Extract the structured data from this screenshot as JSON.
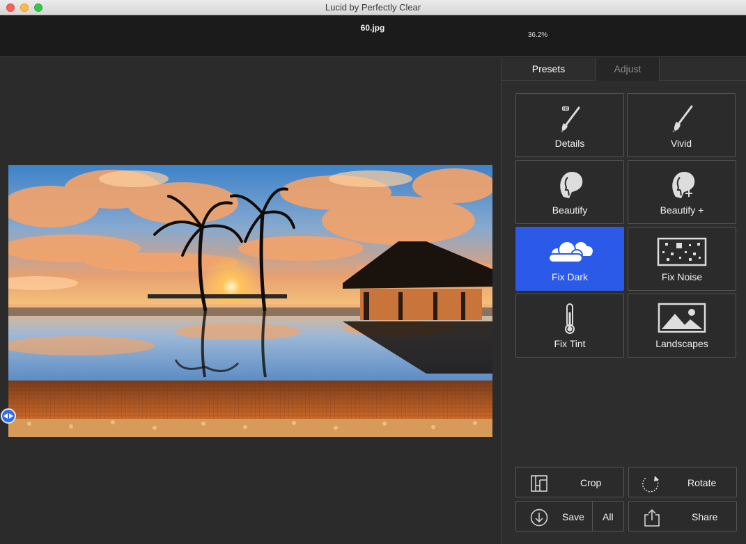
{
  "window": {
    "title": "Lucid by Perfectly Clear"
  },
  "infobar": {
    "filename": "60.jpg",
    "zoom": "36.2%"
  },
  "tabs": [
    {
      "label": "Presets",
      "active": true
    },
    {
      "label": "Adjust",
      "active": false
    }
  ],
  "presets": [
    {
      "label": "Details",
      "icon": "paintbrush-hd-icon"
    },
    {
      "label": "Vivid",
      "icon": "paintbrush-icon"
    },
    {
      "label": "Beautify",
      "icon": "face-profile-icon"
    },
    {
      "label": "Beautify +",
      "icon": "face-profile-plus-icon"
    },
    {
      "label": "Fix Dark",
      "icon": "clouds-icon",
      "active": true
    },
    {
      "label": "Fix Noise",
      "icon": "noise-frame-icon"
    },
    {
      "label": "Fix Tint",
      "icon": "thermometer-icon"
    },
    {
      "label": "Landscapes",
      "icon": "landscape-picture-icon"
    }
  ],
  "actions": {
    "crop": "Crop",
    "rotate": "Rotate",
    "save": "Save",
    "save_all": "All",
    "share": "Share"
  },
  "colors": {
    "accent": "#2b5ae8",
    "panel": "#2d2d2d",
    "infobar": "#1b1b1b"
  }
}
